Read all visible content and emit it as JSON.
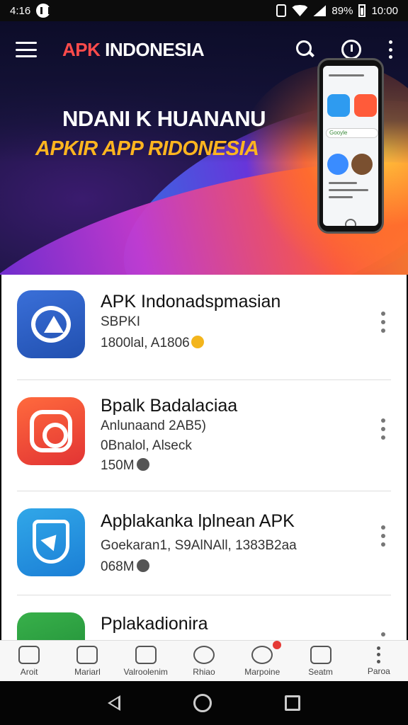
{
  "status_bar": {
    "time_left": "4:16",
    "battery_pct": "89%",
    "time_right": "10:00"
  },
  "app_bar": {
    "brand_accent": "APK",
    "brand_rest": " INDONESIA"
  },
  "banner": {
    "headline": "NDANI K HUANANU",
    "subline": "APKIR APP RIDONESIA",
    "phone_search": "Gooyle"
  },
  "apps": [
    {
      "name": "APK Indonadspmasian",
      "meta1": "SBPKI",
      "meta2": "1800lal, A1806",
      "icon": "android-icon",
      "color": "#2a5cc0"
    },
    {
      "name": "Bpalk Badalaciaa",
      "meta1": "Anlunaand 2AB5)",
      "meta2": "0Bnalol, Alseck",
      "meta3": "150M",
      "icon": "camera-icon",
      "color": "#e6422f"
    },
    {
      "name": "Apþlakanka lplnean APK",
      "meta1": "Goekaran1, S9AlNAll, 1383B2aa",
      "meta2": "068M",
      "icon": "shield-icon",
      "color": "#2290e0"
    },
    {
      "name": "Pplakadionira",
      "icon": "android-green-icon",
      "color": "#2e9e40"
    }
  ],
  "bottom_nav": [
    {
      "label": "Aroit",
      "icon": "home-nav-icon"
    },
    {
      "label": "Mariarl",
      "icon": "apps-grid-icon"
    },
    {
      "label": "Valroolenim",
      "icon": "house-icon"
    },
    {
      "label": "Rhiao",
      "icon": "download-icon"
    },
    {
      "label": "Marpoine",
      "icon": "profile-icon",
      "badge": true
    },
    {
      "label": "Seatm",
      "icon": "share-icon"
    },
    {
      "label": "Paroa",
      "icon": "more-icon"
    }
  ],
  "colors": {
    "accent": "#ff4b4b",
    "gold": "#ffb51f",
    "banner_bg": "#1a1540"
  }
}
